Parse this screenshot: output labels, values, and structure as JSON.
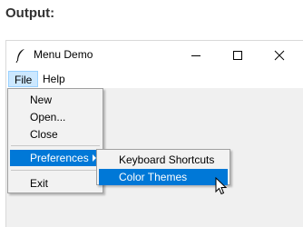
{
  "caption": "Output:",
  "window": {
    "title": "Menu Demo",
    "app_icon": "feather-icon",
    "controls": [
      "minimize-icon",
      "maximize-icon",
      "close-icon"
    ]
  },
  "menubar": {
    "items": [
      {
        "label": "File",
        "active": true
      },
      {
        "label": "Help",
        "active": false
      }
    ]
  },
  "file_menu": {
    "items": [
      {
        "label": "New"
      },
      {
        "label": "Open..."
      },
      {
        "label": "Close"
      },
      {
        "separator": true
      },
      {
        "label": "Preferences",
        "submenu": true,
        "highlighted": true
      },
      {
        "separator": true
      },
      {
        "label": "Exit"
      }
    ]
  },
  "preferences_submenu": {
    "items": [
      {
        "label": "Keyboard Shortcuts"
      },
      {
        "label": "Color Themes",
        "highlighted": true
      }
    ]
  },
  "colors": {
    "highlight": "#0078d7",
    "menubar_active_bg": "#cce8ff",
    "menu_bg": "#f2f2f2",
    "client_bg": "#f0f0f0"
  }
}
